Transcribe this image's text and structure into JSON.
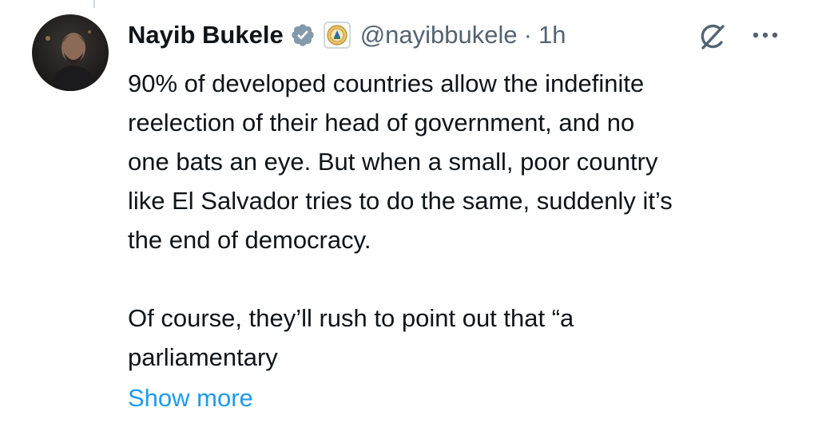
{
  "tweet": {
    "display_name": "Nayib Bukele",
    "handle": "@nayibbukele",
    "separator": "·",
    "time": "1h",
    "body": "90% of developed countries allow the indefinite\nreelection of their head of government, and no\none bats an eye. But when a small, poor country\nlike El Salvador tries to do the same, suddenly it’s\nthe end of democracy.\n\nOf course, they’ll rush to point out that “a\nparliamentary",
    "show_more_label": "Show more"
  },
  "icons": {
    "verified": "verified-badge-icon",
    "affiliate": "government-seal-icon",
    "grok": "grok-icon",
    "more": "more-options-icon"
  },
  "colors": {
    "text_primary": "#0f1419",
    "text_secondary": "#536471",
    "link": "#1d9bf0",
    "verified_badge": "#829aab"
  }
}
